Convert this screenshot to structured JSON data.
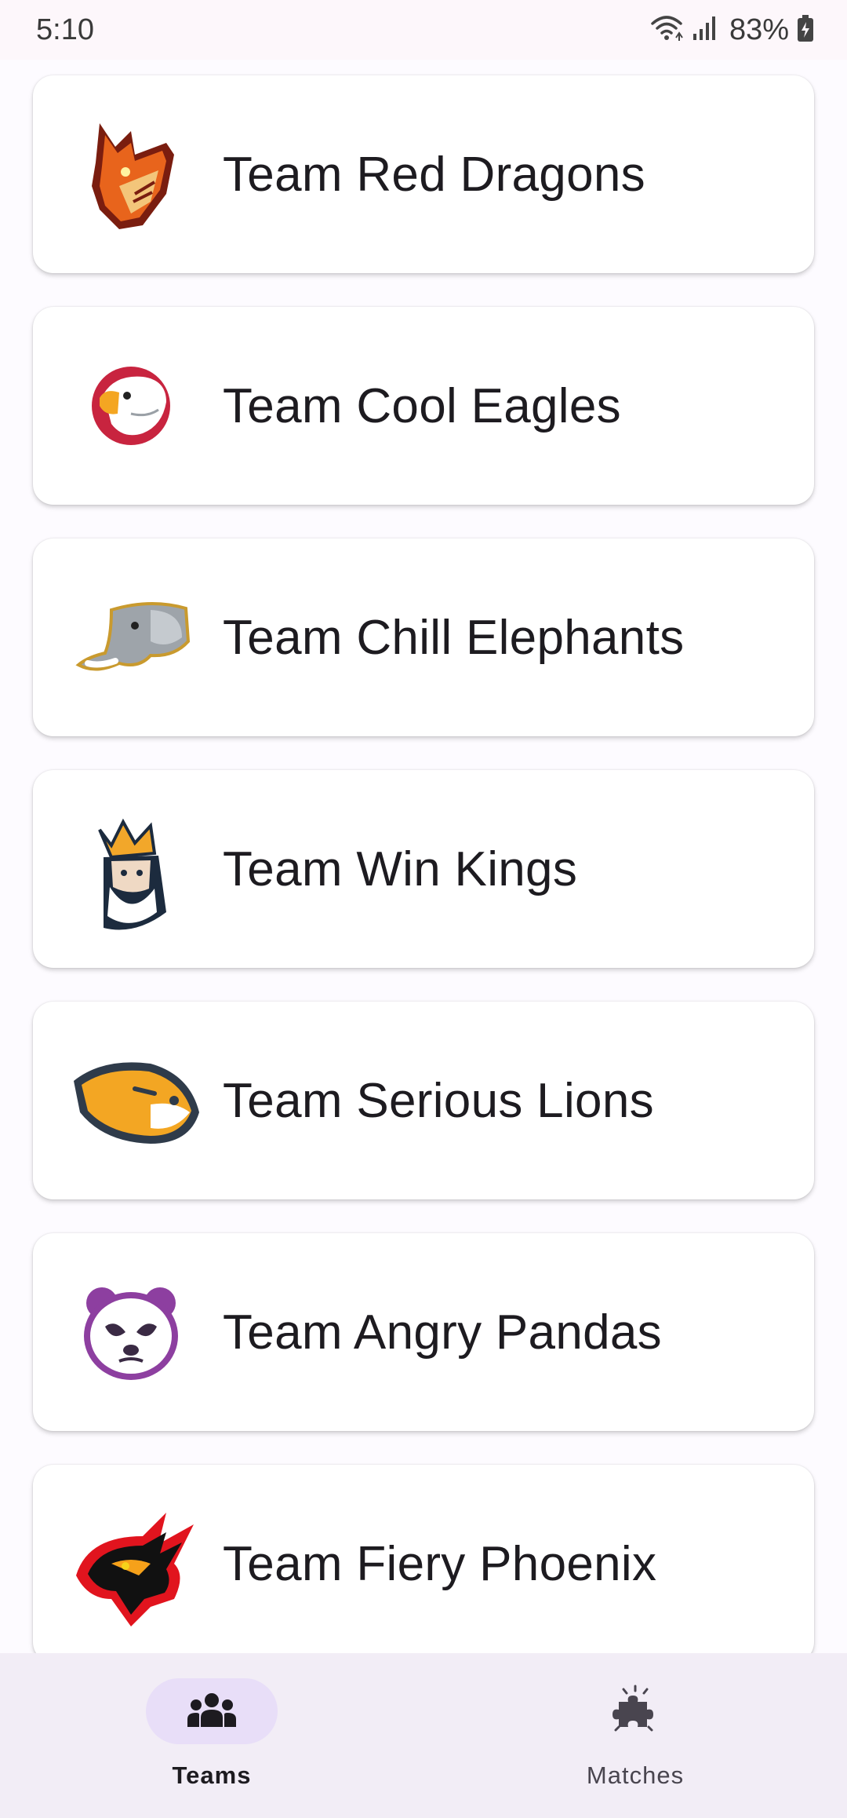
{
  "status_bar": {
    "time": "5:10",
    "battery": "83%",
    "icons": [
      "wifi-icon",
      "signal-icon",
      "battery-charging-icon"
    ]
  },
  "teams": [
    {
      "name": "Team Red Dragons",
      "logo": "dragon-logo"
    },
    {
      "name": "Team Cool Eagles",
      "logo": "eagle-logo"
    },
    {
      "name": "Team Chill Elephants",
      "logo": "elephant-logo"
    },
    {
      "name": "Team Win Kings",
      "logo": "king-logo"
    },
    {
      "name": "Team Serious Lions",
      "logo": "lion-logo"
    },
    {
      "name": "Team Angry Pandas",
      "logo": "panda-logo"
    },
    {
      "name": "Team Fiery Phoenix",
      "logo": "phoenix-logo"
    }
  ],
  "bottom_nav": {
    "teams_label": "Teams",
    "matches_label": "Matches",
    "active": "Teams"
  },
  "colors": {
    "nav_background": "#f2edf6",
    "nav_indicator": "#e8def8",
    "card_background": "#ffffff"
  }
}
